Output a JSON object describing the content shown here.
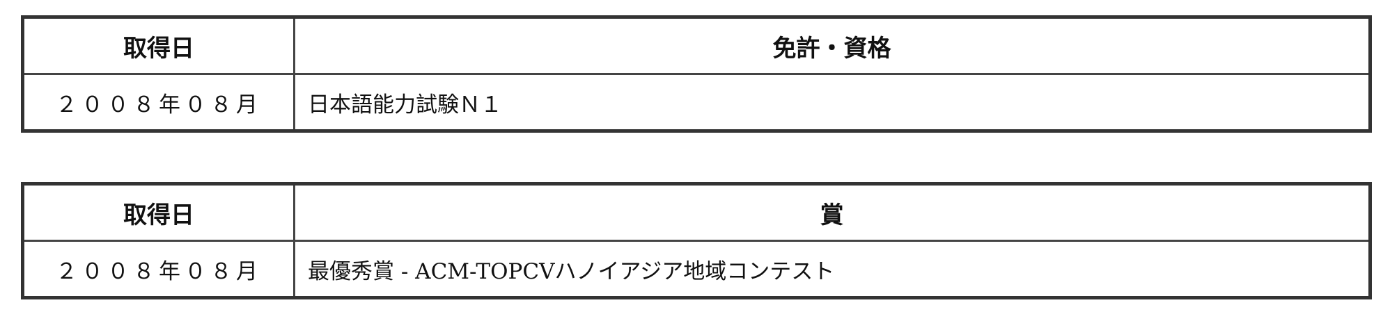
{
  "licenses": {
    "headers": {
      "date": "取得日",
      "item": "免許・資格"
    },
    "rows": [
      {
        "date": "２００８年０８月",
        "item": "日本語能力試験Ｎ１"
      }
    ]
  },
  "awards": {
    "headers": {
      "date": "取得日",
      "item": "賞"
    },
    "rows": [
      {
        "date": "２００８年０８月",
        "item": "最優秀賞 - ACM-TOPCVハノイアジア地域コンテスト"
      }
    ]
  }
}
